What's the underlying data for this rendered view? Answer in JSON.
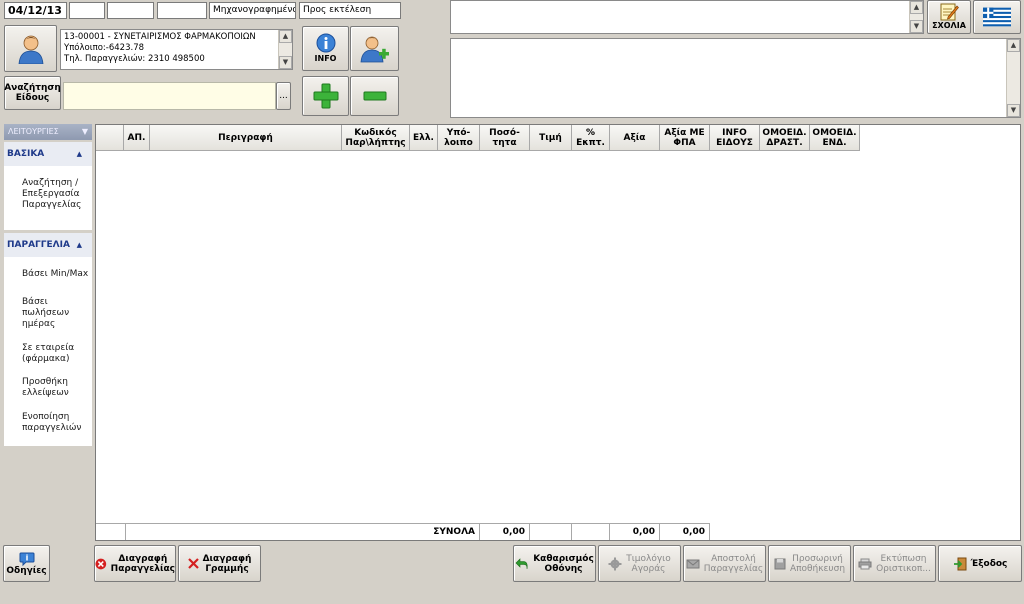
{
  "top": {
    "date": "04/12/13",
    "status_1": "Μηχανογραφημένο",
    "status_2": "Προς εκτέλεση"
  },
  "customer": {
    "line1": "13-00001 - ΣΥΝΕΤΑΙΡΙΣΜΟΣ ΦΑΡΜΑΚΟΠΟΙΩΝ",
    "line2": "Υπόλοιπο:-6423.78",
    "line3": "Τηλ. Παραγγελιών: 2310 498500"
  },
  "buttons": {
    "info": "INFO",
    "search_item_1": "Αναζήτηση",
    "search_item_2": "Είδους",
    "search_dots": "...",
    "sxolia": "ΣΧΟΛΙΑ"
  },
  "sidebar": {
    "header": "ΛΕΙΤΟΥΡΓΙΕΣ",
    "section1": "ΒΑΣΙΚΑ",
    "section1_items": [
      "Αναζήτηση / Επεξεργασία Παραγγελίας"
    ],
    "section2": "ΠΑΡΑΓΓΕΛΙΑ",
    "section2_items": [
      "Βάσει Min/Max",
      "Βάσει πωλήσεων ημέρας",
      "Σε εταιρεία (φάρμακα)",
      "Προσθήκη ελλείψεων",
      "Ενοποίηση παραγγελιών"
    ]
  },
  "grid": {
    "columns": [
      {
        "label": ""
      },
      {
        "label": "ΑΠ."
      },
      {
        "label": "Περιγραφή"
      },
      {
        "label": "Κωδικός Παρ\\λήπτης"
      },
      {
        "label": "Ελλ."
      },
      {
        "label": "Υπό-λοιπο"
      },
      {
        "label": "Ποσό-τητα"
      },
      {
        "label": "Τιμή"
      },
      {
        "label": "% Εκπτ."
      },
      {
        "label": "Αξία"
      },
      {
        "label": "Αξία ΜΕ ΦΠΑ"
      },
      {
        "label": "INFO ΕΙΔΟΥΣ"
      },
      {
        "label": "ΟΜΟΕΙΔ. ΔΡΑΣΤ."
      },
      {
        "label": "ΟΜΟΕΙΔ. ΕΝΔ."
      }
    ],
    "totals": {
      "label": "ΣΥΝΟΛΑ",
      "qty": "0,00",
      "value": "0,00",
      "value_vat": "0,00"
    }
  },
  "bottom": {
    "help": "Οδηγίες",
    "delete_order": [
      "Διαγραφή",
      "Παραγγελίας"
    ],
    "delete_line": [
      "Διαγραφή",
      "Γραμμής"
    ],
    "clear_screen": [
      "Καθαρισμός",
      "Οθόνης"
    ],
    "invoice": [
      "Τιμολόγιο",
      "Αγοράς"
    ],
    "send_order": [
      "Αποστολή",
      "Παραγγελίας"
    ],
    "temp_save": [
      "Προσωρινή",
      "Αποθήκευση"
    ],
    "print_final": [
      "Εκτύπωση",
      "Οριστικοπ..."
    ],
    "exit": "Έξοδος"
  }
}
